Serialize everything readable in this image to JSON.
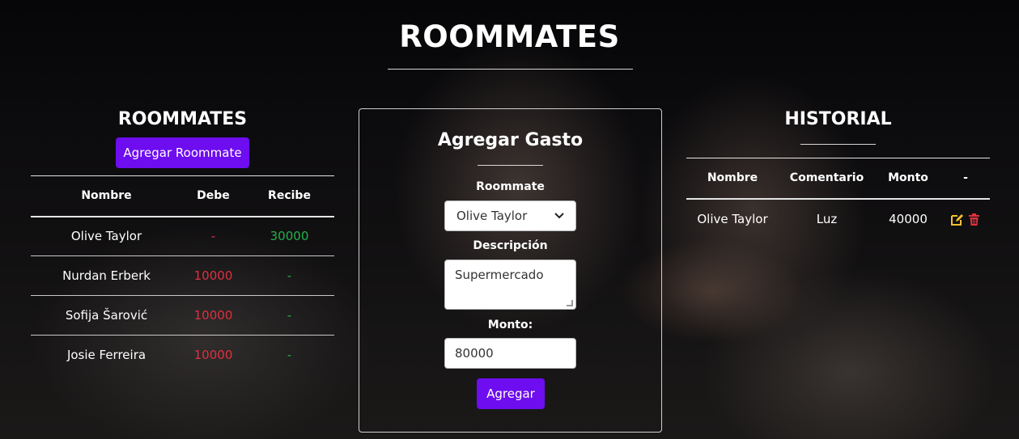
{
  "page": {
    "title": "ROOMMATES"
  },
  "roommates": {
    "title": "ROOMMATES",
    "add_button": "Agregar Roommate",
    "columns": [
      "Nombre",
      "Debe",
      "Recibe"
    ],
    "rows": [
      {
        "nombre": "Olive Taylor",
        "debe": "-",
        "recibe": "30000"
      },
      {
        "nombre": "Nurdan Erberk",
        "debe": "10000",
        "recibe": "-"
      },
      {
        "nombre": "Sofija Šarović",
        "debe": "10000",
        "recibe": "-"
      },
      {
        "nombre": "Josie Ferreira",
        "debe": "10000",
        "recibe": "-"
      }
    ]
  },
  "gasto_form": {
    "title": "Agregar Gasto",
    "roommate_label": "Roommate",
    "roommate_selected": "Olive Taylor",
    "descripcion_label": "Descripción",
    "descripcion_value": "Supermercado",
    "monto_label": "Monto:",
    "monto_value": "80000",
    "submit_label": "Agregar"
  },
  "historial": {
    "title": "HISTORIAL",
    "columns": [
      "Nombre",
      "Comentario",
      "Monto",
      "-"
    ],
    "rows": [
      {
        "nombre": "Olive Taylor",
        "comentario": "Luz",
        "monto": "40000"
      }
    ]
  },
  "colors": {
    "accent": "#6d0df0",
    "debe": "#e0303f",
    "recibe": "#22b14c",
    "edit_icon": "#f2c12e",
    "delete_icon": "#e0303f"
  },
  "icons": {
    "edit": "edit-icon",
    "delete": "trash-icon",
    "select_arrow": "chevron-down-icon"
  }
}
